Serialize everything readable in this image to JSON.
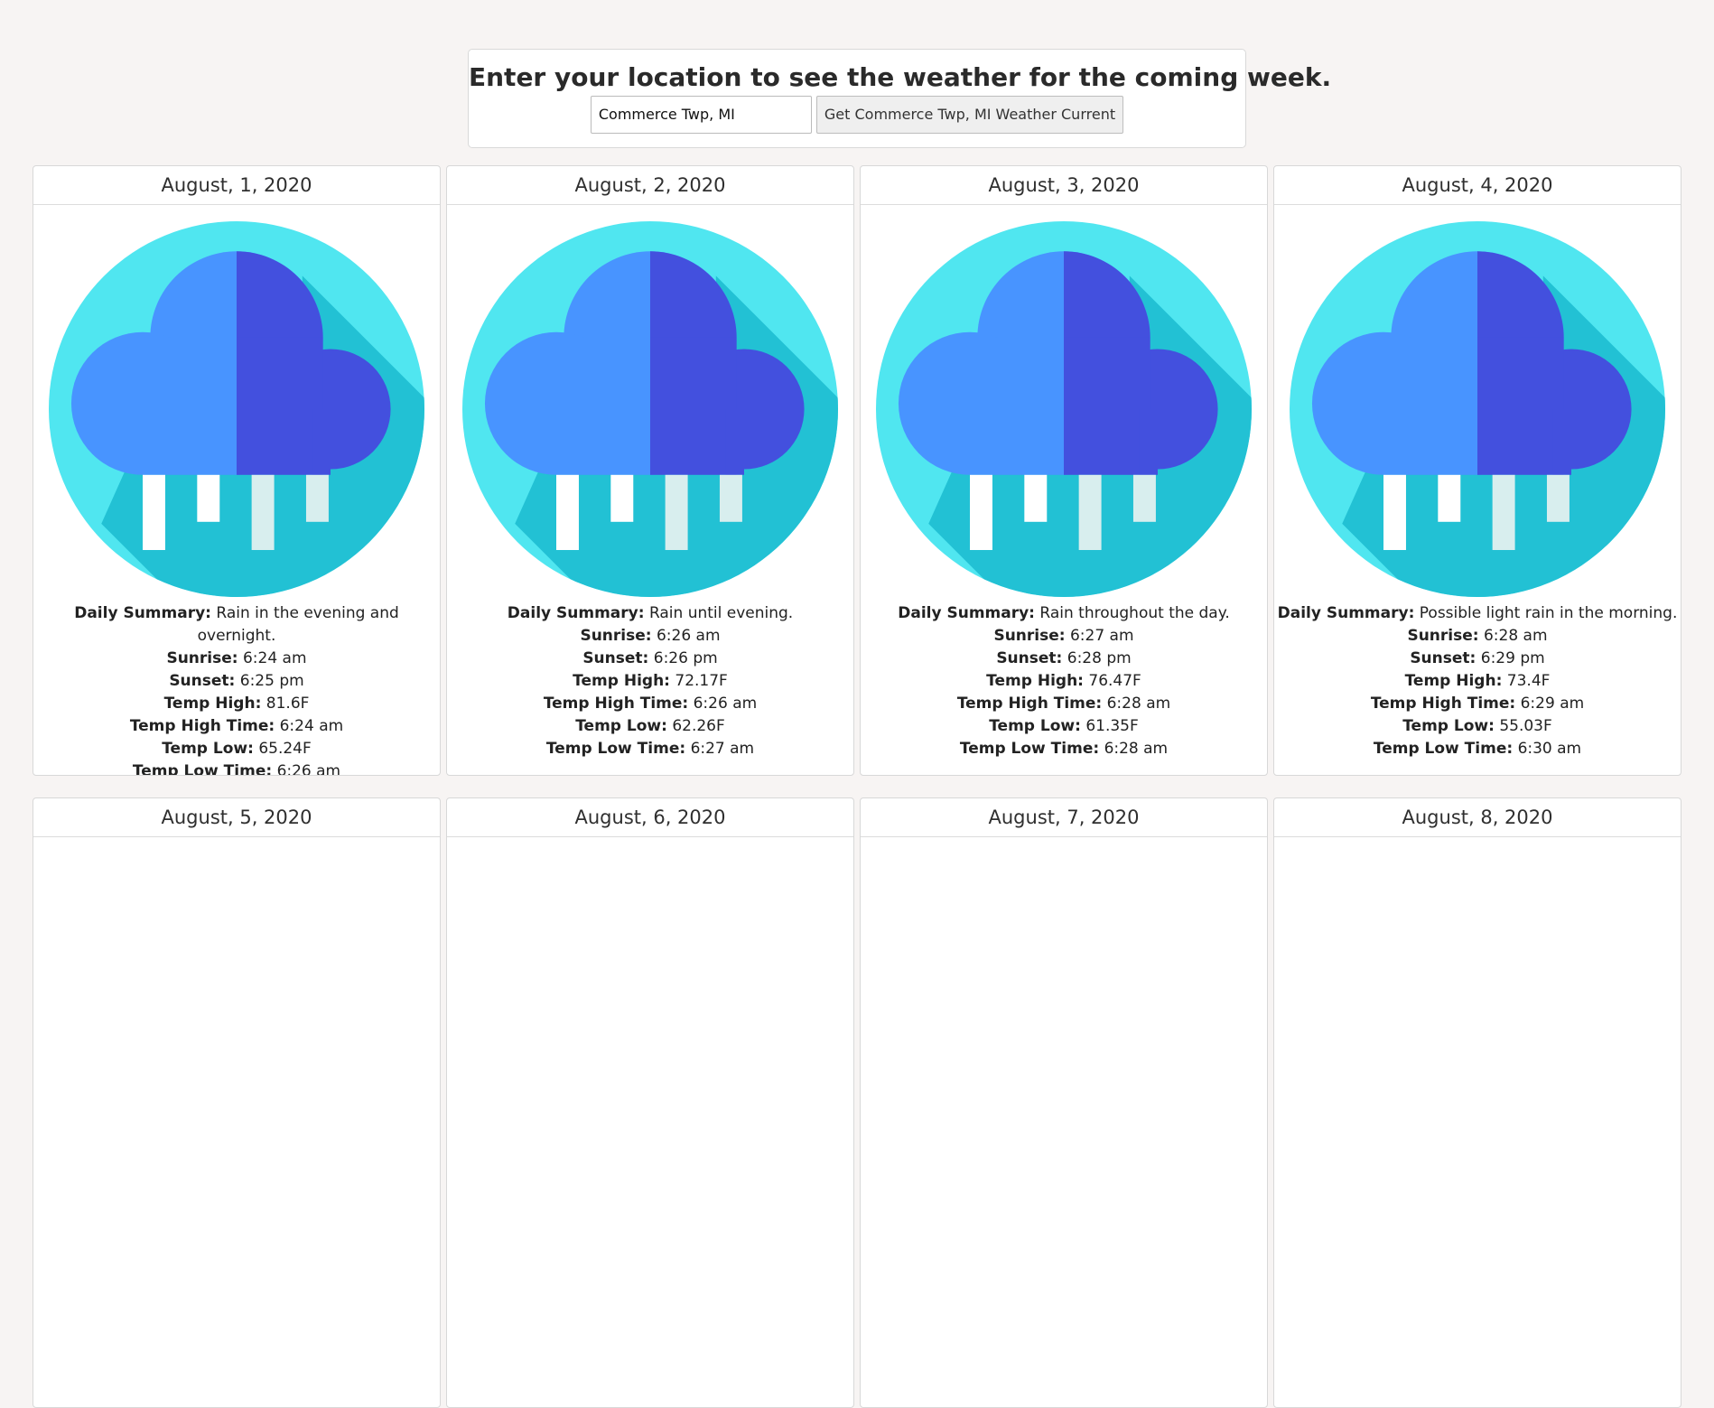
{
  "header": {
    "title": "Enter your location to see the weather for the coming week."
  },
  "search": {
    "value": "Commerce Twp, MI",
    "placeholder": "",
    "button_label": "Get Commerce Twp, MI Weather Current"
  },
  "labels": {
    "summary": "Daily Summary:",
    "sunrise": "Sunrise:",
    "sunset": "Sunset:",
    "temp_high": "Temp High:",
    "temp_high_time": "Temp High Time:",
    "temp_low": "Temp Low:",
    "temp_low_time": "Temp Low Time:"
  },
  "days": [
    {
      "date": "August, 1, 2020",
      "icon": "rain-cloud-icon",
      "summary": "Rain in the evening and overnight.",
      "sunrise": "6:24 am",
      "sunset": "6:25 pm",
      "temp_high": "81.6F",
      "temp_high_time": "6:24 am",
      "temp_low": "65.24F",
      "temp_low_time": "6:26 am"
    },
    {
      "date": "August, 2, 2020",
      "icon": "rain-cloud-icon",
      "summary": "Rain until evening.",
      "sunrise": "6:26 am",
      "sunset": "6:26 pm",
      "temp_high": "72.17F",
      "temp_high_time": "6:26 am",
      "temp_low": "62.26F",
      "temp_low_time": "6:27 am"
    },
    {
      "date": "August, 3, 2020",
      "icon": "rain-cloud-icon",
      "summary": "Rain throughout the day.",
      "sunrise": "6:27 am",
      "sunset": "6:28 pm",
      "temp_high": "76.47F",
      "temp_high_time": "6:28 am",
      "temp_low": "61.35F",
      "temp_low_time": "6:28 am"
    },
    {
      "date": "August, 4, 2020",
      "icon": "rain-cloud-icon",
      "summary": "Possible light rain in the morning.",
      "sunrise": "6:28 am",
      "sunset": "6:29 pm",
      "temp_high": "73.4F",
      "temp_high_time": "6:29 am",
      "temp_low": "55.03F",
      "temp_low_time": "6:30 am"
    },
    {
      "date": "August, 5, 2020"
    },
    {
      "date": "August, 6, 2020"
    },
    {
      "date": "August, 7, 2020"
    },
    {
      "date": "August, 8, 2020"
    }
  ],
  "colors": {
    "page_background": "#f7f4f3",
    "icon_circle": "#50e6f0",
    "icon_shadow": "#22c1d4",
    "cloud_left": "#4894ff",
    "cloud_right": "#4350de",
    "rain_white": "#ffffff",
    "rain_light": "#d8eeee"
  }
}
